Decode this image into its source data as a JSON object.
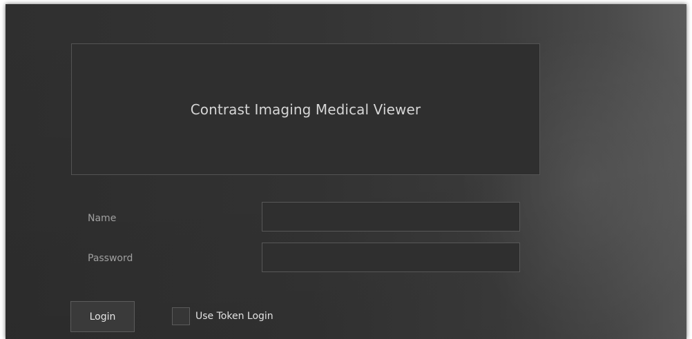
{
  "app": {
    "title": "Contrast Imaging Medical Viewer"
  },
  "form": {
    "name_label": "Name",
    "name_value": "",
    "password_label": "Password",
    "password_value": "",
    "login_label": "Login",
    "token_login_label": "Use Token Login",
    "token_login_checked": false
  },
  "colors": {
    "background": "#333333",
    "panel": "#2f2f2f",
    "border": "#545454",
    "text": "#d6d6d6",
    "label_text": "#a0a0a0"
  }
}
